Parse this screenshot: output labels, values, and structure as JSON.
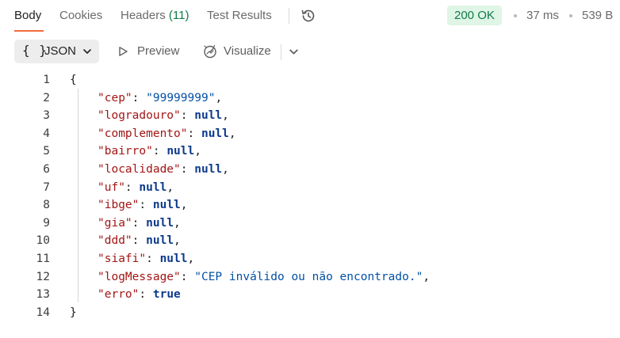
{
  "tabs": {
    "body": "Body",
    "cookies": "Cookies",
    "headers": "Headers",
    "headers_count": "(11)",
    "test_results": "Test Results"
  },
  "status": {
    "code": "200 OK",
    "time": "37 ms",
    "size": "539 B",
    "status_color": "#0f7a46",
    "status_bg": "#dff5e6"
  },
  "toolbar": {
    "format_icon": "{ }",
    "format_label": "JSON",
    "preview_label": "Preview",
    "visualize_label": "Visualize"
  },
  "code": {
    "line_numbers": [
      "1",
      "2",
      "3",
      "4",
      "5",
      "6",
      "7",
      "8",
      "9",
      "10",
      "11",
      "12",
      "13",
      "14"
    ],
    "open_brace": "{",
    "close_brace": "}",
    "entries": [
      {
        "key": "\"cep\"",
        "value": "\"99999999\"",
        "type": "string",
        "comma": ","
      },
      {
        "key": "\"logradouro\"",
        "value": "null",
        "type": "literal",
        "comma": ","
      },
      {
        "key": "\"complemento\"",
        "value": "null",
        "type": "literal",
        "comma": ","
      },
      {
        "key": "\"bairro\"",
        "value": "null",
        "type": "literal",
        "comma": ","
      },
      {
        "key": "\"localidade\"",
        "value": "null",
        "type": "literal",
        "comma": ","
      },
      {
        "key": "\"uf\"",
        "value": "null",
        "type": "literal",
        "comma": ","
      },
      {
        "key": "\"ibge\"",
        "value": "null",
        "type": "literal",
        "comma": ","
      },
      {
        "key": "\"gia\"",
        "value": "null",
        "type": "literal",
        "comma": ","
      },
      {
        "key": "\"ddd\"",
        "value": "null",
        "type": "literal",
        "comma": ","
      },
      {
        "key": "\"siafi\"",
        "value": "null",
        "type": "literal",
        "comma": ","
      },
      {
        "key": "\"logMessage\"",
        "value": "\"CEP inválido ou não encontrado.\"",
        "type": "string",
        "comma": ","
      },
      {
        "key": "\"erro\"",
        "value": "true",
        "type": "literal",
        "comma": ""
      }
    ],
    "colors": {
      "key": "#a31515",
      "string": "#0451a5",
      "literal": "#0d3a8c"
    }
  }
}
